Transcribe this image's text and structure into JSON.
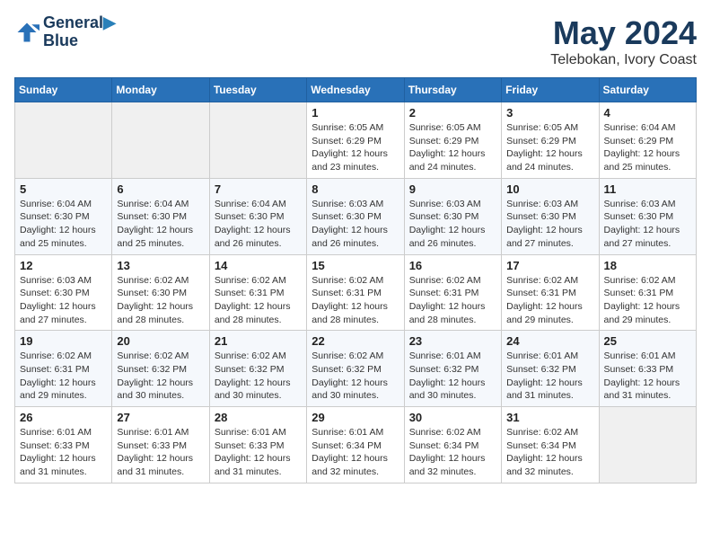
{
  "logo": {
    "line1": "General",
    "line2": "Blue"
  },
  "title": "May 2024",
  "location": "Telebokan, Ivory Coast",
  "weekdays": [
    "Sunday",
    "Monday",
    "Tuesday",
    "Wednesday",
    "Thursday",
    "Friday",
    "Saturday"
  ],
  "weeks": [
    [
      {
        "day": "",
        "info": ""
      },
      {
        "day": "",
        "info": ""
      },
      {
        "day": "",
        "info": ""
      },
      {
        "day": "1",
        "sunrise": "6:05 AM",
        "sunset": "6:29 PM",
        "daylight": "12 hours and 23 minutes."
      },
      {
        "day": "2",
        "sunrise": "6:05 AM",
        "sunset": "6:29 PM",
        "daylight": "12 hours and 24 minutes."
      },
      {
        "day": "3",
        "sunrise": "6:05 AM",
        "sunset": "6:29 PM",
        "daylight": "12 hours and 24 minutes."
      },
      {
        "day": "4",
        "sunrise": "6:04 AM",
        "sunset": "6:29 PM",
        "daylight": "12 hours and 25 minutes."
      }
    ],
    [
      {
        "day": "5",
        "sunrise": "6:04 AM",
        "sunset": "6:30 PM",
        "daylight": "12 hours and 25 minutes."
      },
      {
        "day": "6",
        "sunrise": "6:04 AM",
        "sunset": "6:30 PM",
        "daylight": "12 hours and 25 minutes."
      },
      {
        "day": "7",
        "sunrise": "6:04 AM",
        "sunset": "6:30 PM",
        "daylight": "12 hours and 26 minutes."
      },
      {
        "day": "8",
        "sunrise": "6:03 AM",
        "sunset": "6:30 PM",
        "daylight": "12 hours and 26 minutes."
      },
      {
        "day": "9",
        "sunrise": "6:03 AM",
        "sunset": "6:30 PM",
        "daylight": "12 hours and 26 minutes."
      },
      {
        "day": "10",
        "sunrise": "6:03 AM",
        "sunset": "6:30 PM",
        "daylight": "12 hours and 27 minutes."
      },
      {
        "day": "11",
        "sunrise": "6:03 AM",
        "sunset": "6:30 PM",
        "daylight": "12 hours and 27 minutes."
      }
    ],
    [
      {
        "day": "12",
        "sunrise": "6:03 AM",
        "sunset": "6:30 PM",
        "daylight": "12 hours and 27 minutes."
      },
      {
        "day": "13",
        "sunrise": "6:02 AM",
        "sunset": "6:30 PM",
        "daylight": "12 hours and 28 minutes."
      },
      {
        "day": "14",
        "sunrise": "6:02 AM",
        "sunset": "6:31 PM",
        "daylight": "12 hours and 28 minutes."
      },
      {
        "day": "15",
        "sunrise": "6:02 AM",
        "sunset": "6:31 PM",
        "daylight": "12 hours and 28 minutes."
      },
      {
        "day": "16",
        "sunrise": "6:02 AM",
        "sunset": "6:31 PM",
        "daylight": "12 hours and 28 minutes."
      },
      {
        "day": "17",
        "sunrise": "6:02 AM",
        "sunset": "6:31 PM",
        "daylight": "12 hours and 29 minutes."
      },
      {
        "day": "18",
        "sunrise": "6:02 AM",
        "sunset": "6:31 PM",
        "daylight": "12 hours and 29 minutes."
      }
    ],
    [
      {
        "day": "19",
        "sunrise": "6:02 AM",
        "sunset": "6:31 PM",
        "daylight": "12 hours and 29 minutes."
      },
      {
        "day": "20",
        "sunrise": "6:02 AM",
        "sunset": "6:32 PM",
        "daylight": "12 hours and 30 minutes."
      },
      {
        "day": "21",
        "sunrise": "6:02 AM",
        "sunset": "6:32 PM",
        "daylight": "12 hours and 30 minutes."
      },
      {
        "day": "22",
        "sunrise": "6:02 AM",
        "sunset": "6:32 PM",
        "daylight": "12 hours and 30 minutes."
      },
      {
        "day": "23",
        "sunrise": "6:01 AM",
        "sunset": "6:32 PM",
        "daylight": "12 hours and 30 minutes."
      },
      {
        "day": "24",
        "sunrise": "6:01 AM",
        "sunset": "6:32 PM",
        "daylight": "12 hours and 31 minutes."
      },
      {
        "day": "25",
        "sunrise": "6:01 AM",
        "sunset": "6:33 PM",
        "daylight": "12 hours and 31 minutes."
      }
    ],
    [
      {
        "day": "26",
        "sunrise": "6:01 AM",
        "sunset": "6:33 PM",
        "daylight": "12 hours and 31 minutes."
      },
      {
        "day": "27",
        "sunrise": "6:01 AM",
        "sunset": "6:33 PM",
        "daylight": "12 hours and 31 minutes."
      },
      {
        "day": "28",
        "sunrise": "6:01 AM",
        "sunset": "6:33 PM",
        "daylight": "12 hours and 31 minutes."
      },
      {
        "day": "29",
        "sunrise": "6:01 AM",
        "sunset": "6:34 PM",
        "daylight": "12 hours and 32 minutes."
      },
      {
        "day": "30",
        "sunrise": "6:02 AM",
        "sunset": "6:34 PM",
        "daylight": "12 hours and 32 minutes."
      },
      {
        "day": "31",
        "sunrise": "6:02 AM",
        "sunset": "6:34 PM",
        "daylight": "12 hours and 32 minutes."
      },
      {
        "day": "",
        "info": ""
      }
    ]
  ],
  "labels": {
    "sunrise_prefix": "Sunrise: ",
    "sunset_prefix": "Sunset: ",
    "daylight_prefix": "Daylight: "
  }
}
